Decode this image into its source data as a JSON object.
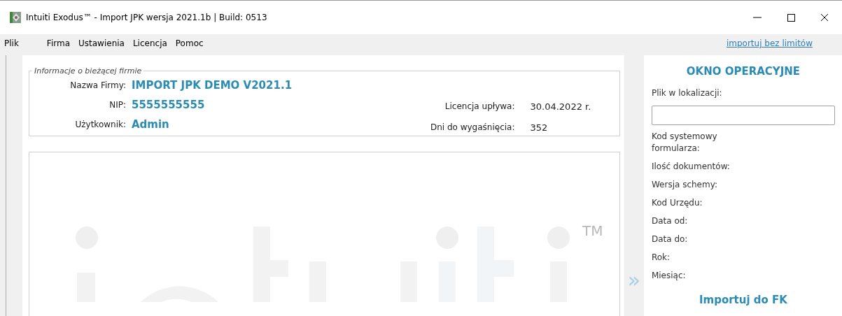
{
  "window": {
    "title": "Intuiti Exodus™ - Import JPK wersja 2021.1b | Build: 0513"
  },
  "menu": [
    "Plik",
    "Firma",
    "Ustawienia",
    "Licencja",
    "Pomoc"
  ],
  "top_link": "importuj bez limitów",
  "company_info": {
    "legend": "Informacje o bieżącej firmie",
    "left": [
      {
        "label": "Nazwa Firmy:",
        "value": "IMPORT JPK DEMO V2021.1"
      },
      {
        "label": "NIP:",
        "value": "5555555555"
      },
      {
        "label": "Użytkownik:",
        "value": "Admin"
      }
    ],
    "right": [
      {
        "label": "Licencja upływa:",
        "value": "30.04.2022 r."
      },
      {
        "label": "Dni do wygaśnięcia:",
        "value": "352"
      }
    ]
  },
  "logo_mark": "TM",
  "expand_glyph": "»",
  "operation_panel": {
    "title": "OKNO OPERACYJNE",
    "file_label": "Plik w lokalizacji:",
    "fields": [
      "Kod systemowy formularza:",
      "Ilość dokumentów:",
      "Wersja schemy:",
      "Kod Urzędu:",
      "Data od:",
      "Data do:",
      "Rok:",
      "Miesiąc:"
    ],
    "action": "Importuj do FK"
  }
}
